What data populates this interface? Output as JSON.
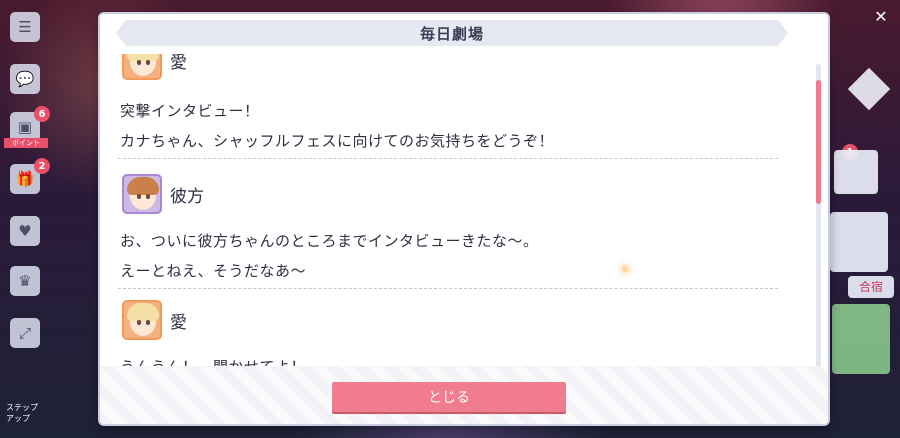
{
  "dialog": {
    "title": "毎日劇場",
    "close_label": "とじる"
  },
  "entries": [
    {
      "speaker": "愛",
      "avatar": "ai-portrait",
      "lines": [
        "突撃インタビュー！",
        "カナちゃん、シャッフルフェスに向けてのお気持ちをどうぞ！"
      ]
    },
    {
      "speaker": "彼方",
      "avatar": "kanata-portrait",
      "lines": [
        "お、ついに彼方ちゃんのところまでインタビューきたな〜。",
        "えーとねえ、そうだなあ〜"
      ]
    },
    {
      "speaker": "愛",
      "avatar": "ai-portrait",
      "lines": [
        "うんうん！　聞かせてよ！"
      ]
    }
  ],
  "scroll": {
    "position": 0.05,
    "visible_fraction": 0.4
  },
  "left_rail": {
    "badges": [
      "6",
      "2"
    ],
    "ribbon": "ポイント",
    "caption": "ステップ\nアップ"
  },
  "right_rail": {
    "badge": "1",
    "card_label": "合宿"
  },
  "colors": {
    "accent": "#f07c8e",
    "title_bar": "#e6e8f1",
    "scroll_thumb": "#f07a8e",
    "text": "#2e3142"
  }
}
